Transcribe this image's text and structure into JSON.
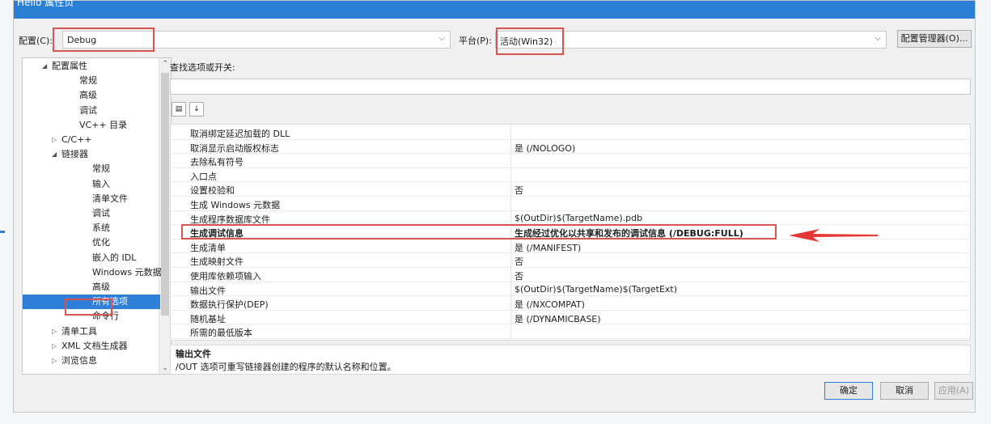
{
  "window_title": "Hello 属性页",
  "config_label": "配置(C):",
  "config_value": "Debug",
  "platform_label": "平台(P):",
  "platform_value": "活动(Win32)",
  "config_manager_button": "配置管理器(O)...",
  "tree_items": [
    {
      "label": "配置属性",
      "prefix": "◢"
    },
    {
      "label": "常规",
      "prefix": ""
    },
    {
      "label": "高级",
      "prefix": ""
    },
    {
      "label": "调试",
      "prefix": ""
    },
    {
      "label": "VC++ 目录",
      "prefix": ""
    },
    {
      "label": "C/C++",
      "prefix": "▷"
    },
    {
      "label": "链接器",
      "prefix": "◢"
    },
    {
      "label": "常规",
      "prefix": ""
    },
    {
      "label": "输入",
      "prefix": ""
    },
    {
      "label": "清单文件",
      "prefix": ""
    },
    {
      "label": "调试",
      "prefix": ""
    },
    {
      "label": "系统",
      "prefix": ""
    },
    {
      "label": "优化",
      "prefix": ""
    },
    {
      "label": "嵌入的 IDL",
      "prefix": ""
    },
    {
      "label": "Windows 元数据",
      "prefix": ""
    },
    {
      "label": "高级",
      "prefix": ""
    },
    {
      "label": "所有选项",
      "prefix": ""
    },
    {
      "label": "命令行",
      "prefix": ""
    },
    {
      "label": "清单工具",
      "prefix": "▷"
    },
    {
      "label": "XML 文档生成器",
      "prefix": "▷"
    },
    {
      "label": "浏览信息",
      "prefix": "▷"
    }
  ],
  "search_label": "查找选项或开关:",
  "search_value": "",
  "properties": [
    {
      "name": "取消绑定延迟加载的 DLL",
      "value": ""
    },
    {
      "name": "取消显示启动版权标志",
      "value": "是 (/NOLOGO)"
    },
    {
      "name": "去除私有符号",
      "value": ""
    },
    {
      "name": "入口点",
      "value": ""
    },
    {
      "name": "设置校验和",
      "value": "否"
    },
    {
      "name": "生成 Windows 元数据",
      "value": ""
    },
    {
      "name": "生成程序数据库文件",
      "value": "$(OutDir)$(TargetName).pdb"
    },
    {
      "name": "生成调试信息",
      "value": "生成经过优化以共享和发布的调试信息 (/DEBUG:FULL)"
    },
    {
      "name": "生成清单",
      "value": "是 (/MANIFEST)"
    },
    {
      "name": "生成映射文件",
      "value": "否"
    },
    {
      "name": "使用库依赖项输入",
      "value": "否"
    },
    {
      "name": "输出文件",
      "value": "$(OutDir)$(TargetName)$(TargetExt)"
    },
    {
      "name": "数据执行保护(DEP)",
      "value": "是 (/NXCOMPAT)"
    },
    {
      "name": "随机基址",
      "value": "是 (/DYNAMICBASE)"
    },
    {
      "name": "所需的最低版本",
      "value": ""
    }
  ],
  "description_title": "输出文件",
  "description_text": "/OUT 选项可重写链接器创建的程序的默认名称和位置。",
  "ok_button": "确定",
  "cancel_button": "取消",
  "apply_button": "应用(A)",
  "accent_color": "#2f7fd9",
  "highlight_color": "#d9534f"
}
